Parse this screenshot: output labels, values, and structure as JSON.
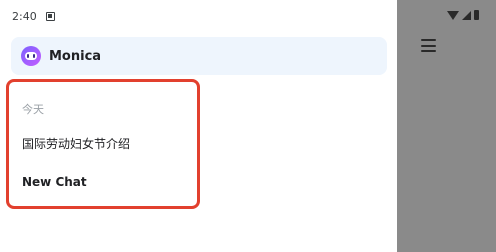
{
  "status_bar": {
    "time": "2:40"
  },
  "app": {
    "name": "Monica"
  },
  "history": {
    "section_label": "今天",
    "items": [
      {
        "label": "国际劳动妇女节介绍"
      },
      {
        "label": "New Chat"
      }
    ]
  },
  "colors": {
    "card_bg": "#eef5fd",
    "highlight_border": "#e2402e",
    "scrim": "#8a8a8a"
  },
  "icons": {
    "notification": "notification-icon",
    "wifi": "wifi-icon",
    "signal": "signal-icon",
    "battery": "battery-icon",
    "menu": "hamburger-menu-icon",
    "logo": "monica-logo"
  }
}
